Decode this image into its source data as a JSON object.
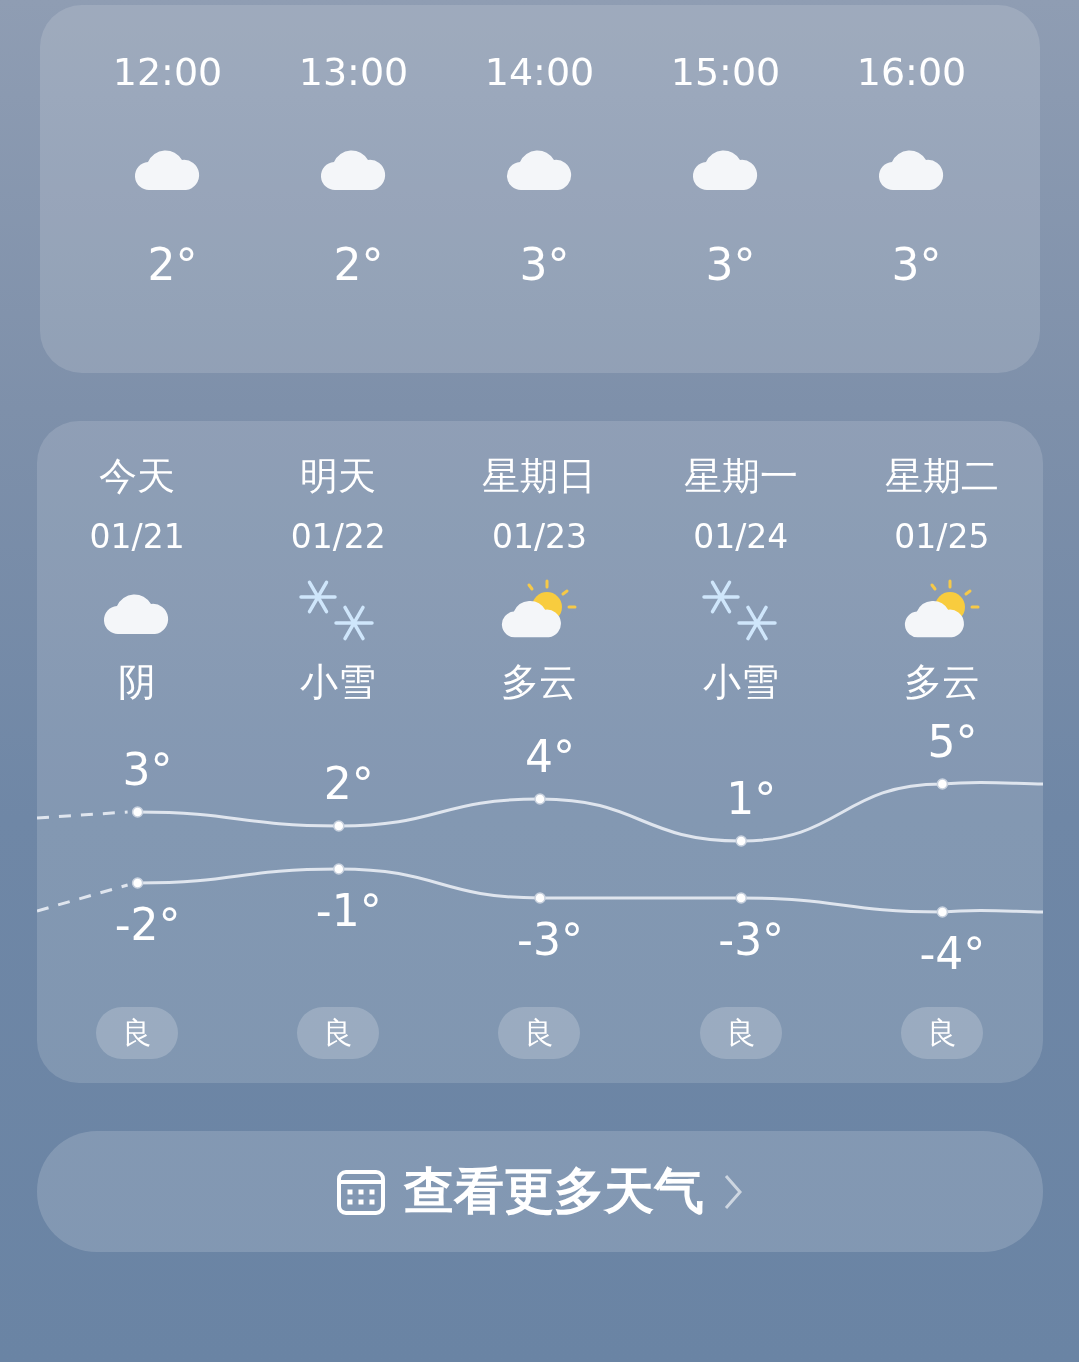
{
  "hourly": [
    {
      "time": "12:00",
      "kind": "cloudy",
      "temp": "2°"
    },
    {
      "time": "13:00",
      "kind": "cloudy",
      "temp": "2°"
    },
    {
      "time": "14:00",
      "kind": "cloudy",
      "temp": "3°"
    },
    {
      "time": "15:00",
      "kind": "cloudy",
      "temp": "3°"
    },
    {
      "time": "16:00",
      "kind": "cloudy",
      "temp": "3°"
    }
  ],
  "daily": {
    "days": [
      {
        "day": "今天",
        "date": "01/21",
        "kind": "cloudy",
        "condition": "阴",
        "high": "3°",
        "low": "-2°",
        "aqi": "良"
      },
      {
        "day": "明天",
        "date": "01/22",
        "kind": "snow",
        "condition": "小雪",
        "high": "2°",
        "low": "-1°",
        "aqi": "良"
      },
      {
        "day": "星期日",
        "date": "01/23",
        "kind": "partly_cloudy",
        "condition": "多云",
        "high": "4°",
        "low": "-3°",
        "aqi": "良"
      },
      {
        "day": "星期一",
        "date": "01/24",
        "kind": "snow",
        "condition": "小雪",
        "high": "1°",
        "low": "-3°",
        "aqi": "良"
      },
      {
        "day": "星期二",
        "date": "01/25",
        "kind": "partly_cloudy",
        "condition": "多云",
        "high": "5°",
        "low": "-4°",
        "aqi": "良"
      }
    ]
  },
  "more_button": {
    "label": "查看更多天气"
  }
}
